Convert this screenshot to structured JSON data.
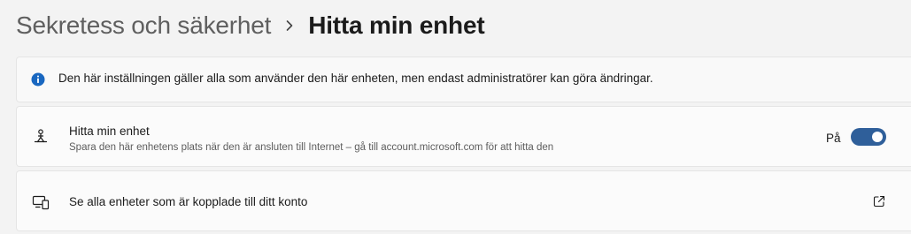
{
  "breadcrumb": {
    "parent": "Sekretess och säkerhet",
    "separator_icon": "chevron-right-icon",
    "current": "Hitta min enhet"
  },
  "info_bar": {
    "icon": "info-icon",
    "text": "Den här inställningen gäller alla som använder den här enheten, men endast administratörer kan göra ändringar."
  },
  "find_my_device": {
    "icon": "person-location-icon",
    "title": "Hitta min enhet",
    "subtitle": "Spara den här enhetens plats när den är ansluten till Internet – gå till account.microsoft.com för att hitta den",
    "toggle_state_label": "På",
    "toggle_on": true
  },
  "devices_link": {
    "icon": "devices-icon",
    "title": "Se alla enheter som är kopplade till ditt konto",
    "action_icon": "open-external-icon"
  },
  "colors": {
    "accent": "#2f5f9a",
    "background": "#f3f3f3",
    "card": "#fbfbfb"
  }
}
